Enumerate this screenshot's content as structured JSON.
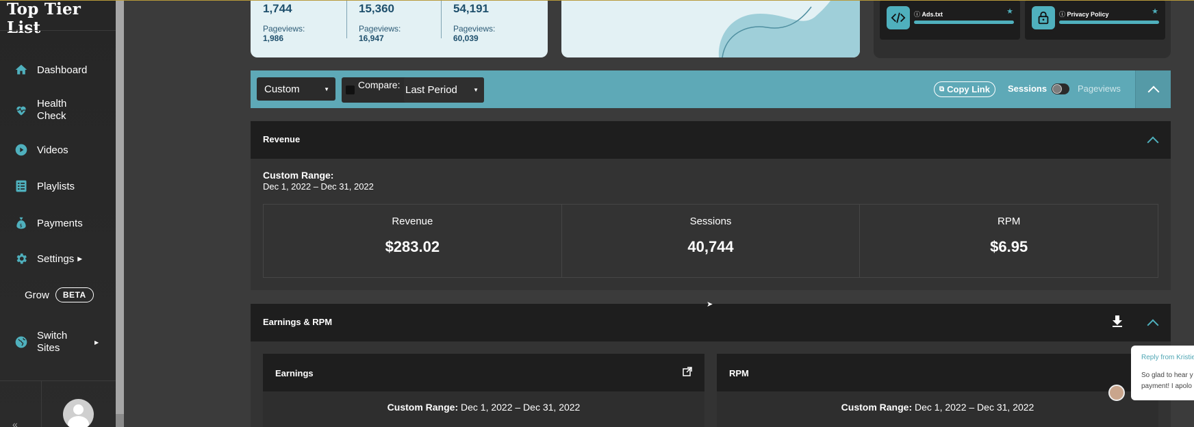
{
  "brand": {
    "name": "Top Tier List"
  },
  "sidebar": {
    "items": [
      {
        "label": "Dashboard",
        "icon": "home-icon"
      },
      {
        "label": "Health Check",
        "icon": "heartbeat-icon"
      },
      {
        "label": "Videos",
        "icon": "play-icon"
      },
      {
        "label": "Playlists",
        "icon": "list-icon"
      },
      {
        "label": "Payments",
        "icon": "money-bag-icon"
      },
      {
        "label": "Settings",
        "icon": "gear-icon"
      },
      {
        "label": "Switch Sites",
        "icon": "globe-icon"
      }
    ],
    "grow": {
      "label": "Grow",
      "badge": "BETA"
    },
    "collapse_glyph": "«"
  },
  "stats": [
    {
      "value": "1,744",
      "pv_label": "Pageviews:",
      "pv_value": "1,986"
    },
    {
      "value": "15,360",
      "pv_label": "Pageviews:",
      "pv_value": "16,947"
    },
    {
      "value": "54,191",
      "pv_label": "Pageviews:",
      "pv_value": "60,039"
    }
  ],
  "tools": [
    {
      "label": "Ads.txt",
      "icon": "code-icon"
    },
    {
      "label": "Privacy Policy",
      "icon": "lock-icon"
    }
  ],
  "filter_bar": {
    "range_select": "Custom",
    "compare_label": "Compare:",
    "compare_select": "Last Period",
    "copy_link": "Copy Link",
    "sessions": "Sessions",
    "pageviews": "Pageviews"
  },
  "revenue": {
    "title": "Revenue",
    "range_title": "Custom Range:",
    "range_dates": "Dec 1, 2022 – Dec 31, 2022",
    "metrics": [
      {
        "label": "Revenue",
        "value": "$283.02"
      },
      {
        "label": "Sessions",
        "value": "40,744"
      },
      {
        "label": "RPM",
        "value": "$6.95"
      }
    ]
  },
  "earnings_rpm": {
    "title": "Earnings & RPM",
    "cards": [
      {
        "title": "Earnings",
        "range_label": "Custom Range:",
        "range_dates": "Dec 1, 2022 – Dec 31, 2022"
      },
      {
        "title": "RPM",
        "range_label": "Custom Range:",
        "range_dates": "Dec 1, 2022 – Dec 31, 2022"
      }
    ]
  },
  "chat": {
    "from": "Reply from Kristie",
    "message_line1": "So glad to hear y",
    "message_line2": "payment! I apolo"
  },
  "colors": {
    "accent": "#4fb0bd",
    "filter_bar": "#5ea9b7",
    "card_light": "#e3f1f4",
    "stat_text": "#1e4f6c"
  }
}
